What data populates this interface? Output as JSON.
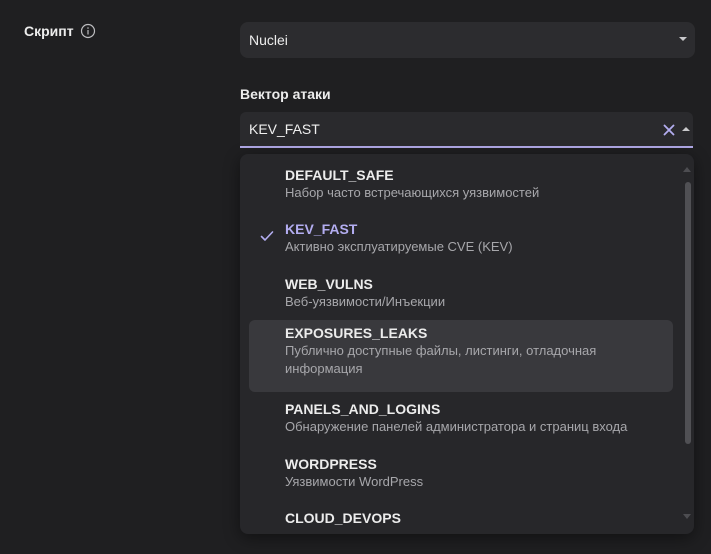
{
  "script_field": {
    "label": "Скрипт",
    "value": "Nuclei"
  },
  "attack_vector": {
    "label": "Вектор атаки",
    "value": "KEV_FAST"
  },
  "options": [
    {
      "title": "DEFAULT_SAFE",
      "description": "Набор часто встречающихся уязвимостей"
    },
    {
      "title": "KEV_FAST",
      "description": "Активно эксплуатируемые CVE (KEV)"
    },
    {
      "title": "WEB_VULNS",
      "description": "Веб-уязвимости/Инъекции"
    },
    {
      "title": "EXPOSURES_LEAKS",
      "description_line1": "Публично доступные файлы, листинги, отладочная",
      "description_line2": "информация"
    },
    {
      "title": "PANELS_AND_LOGINS",
      "description": "Обнаружение панелей администратора и страниц входа"
    },
    {
      "title": "WORDPRESS",
      "description": "Уязвимости WordPress"
    },
    {
      "title": "CLOUD_DEVOPS"
    }
  ],
  "colors": {
    "background": "#1f1f21",
    "field": "#2c2c2f",
    "accent": "#b3adf0",
    "dropdown": "#27272a",
    "hover": "#39393d"
  }
}
